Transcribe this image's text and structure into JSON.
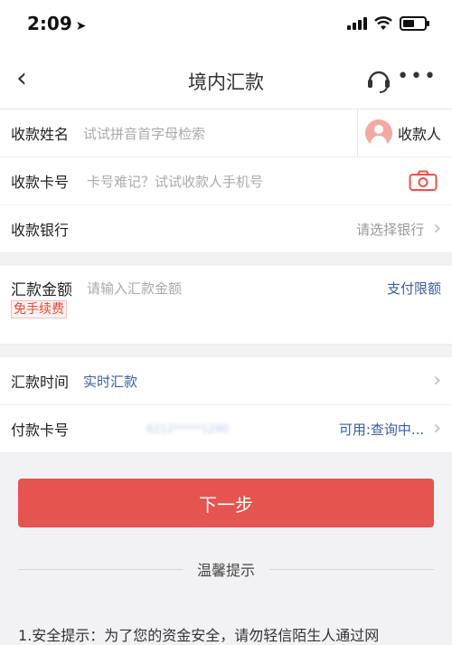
{
  "status": {
    "time": "2:09",
    "battery_level": 0.55
  },
  "nav": {
    "title": "境内汇款"
  },
  "form": {
    "payee_name": {
      "label": "收款姓名",
      "placeholder": "试试拼音首字母检索",
      "payee_button": "收款人"
    },
    "card_no": {
      "label": "收款卡号",
      "placeholder": "卡号难记？试试收款人手机号"
    },
    "bank": {
      "label": "收款银行",
      "value": "请选择银行"
    },
    "amount": {
      "label": "汇款金额",
      "placeholder": "请输入汇款金额",
      "limit_link": "支付限额",
      "fee_badge": "免手续费"
    },
    "time": {
      "label": "汇款时间",
      "value": "实时汇款"
    },
    "pay_card": {
      "label": "付款卡号",
      "masked": "6212*****1290",
      "balance": "可用:查询中..."
    }
  },
  "next_button": "下一步",
  "tips": {
    "title": "温馨提示",
    "line1": "1.安全提示：为了您的资金安全，请勿轻信陌生人通过网"
  },
  "colors": {
    "accent_red": "#e5544e",
    "link_blue": "#3a5f9a"
  }
}
